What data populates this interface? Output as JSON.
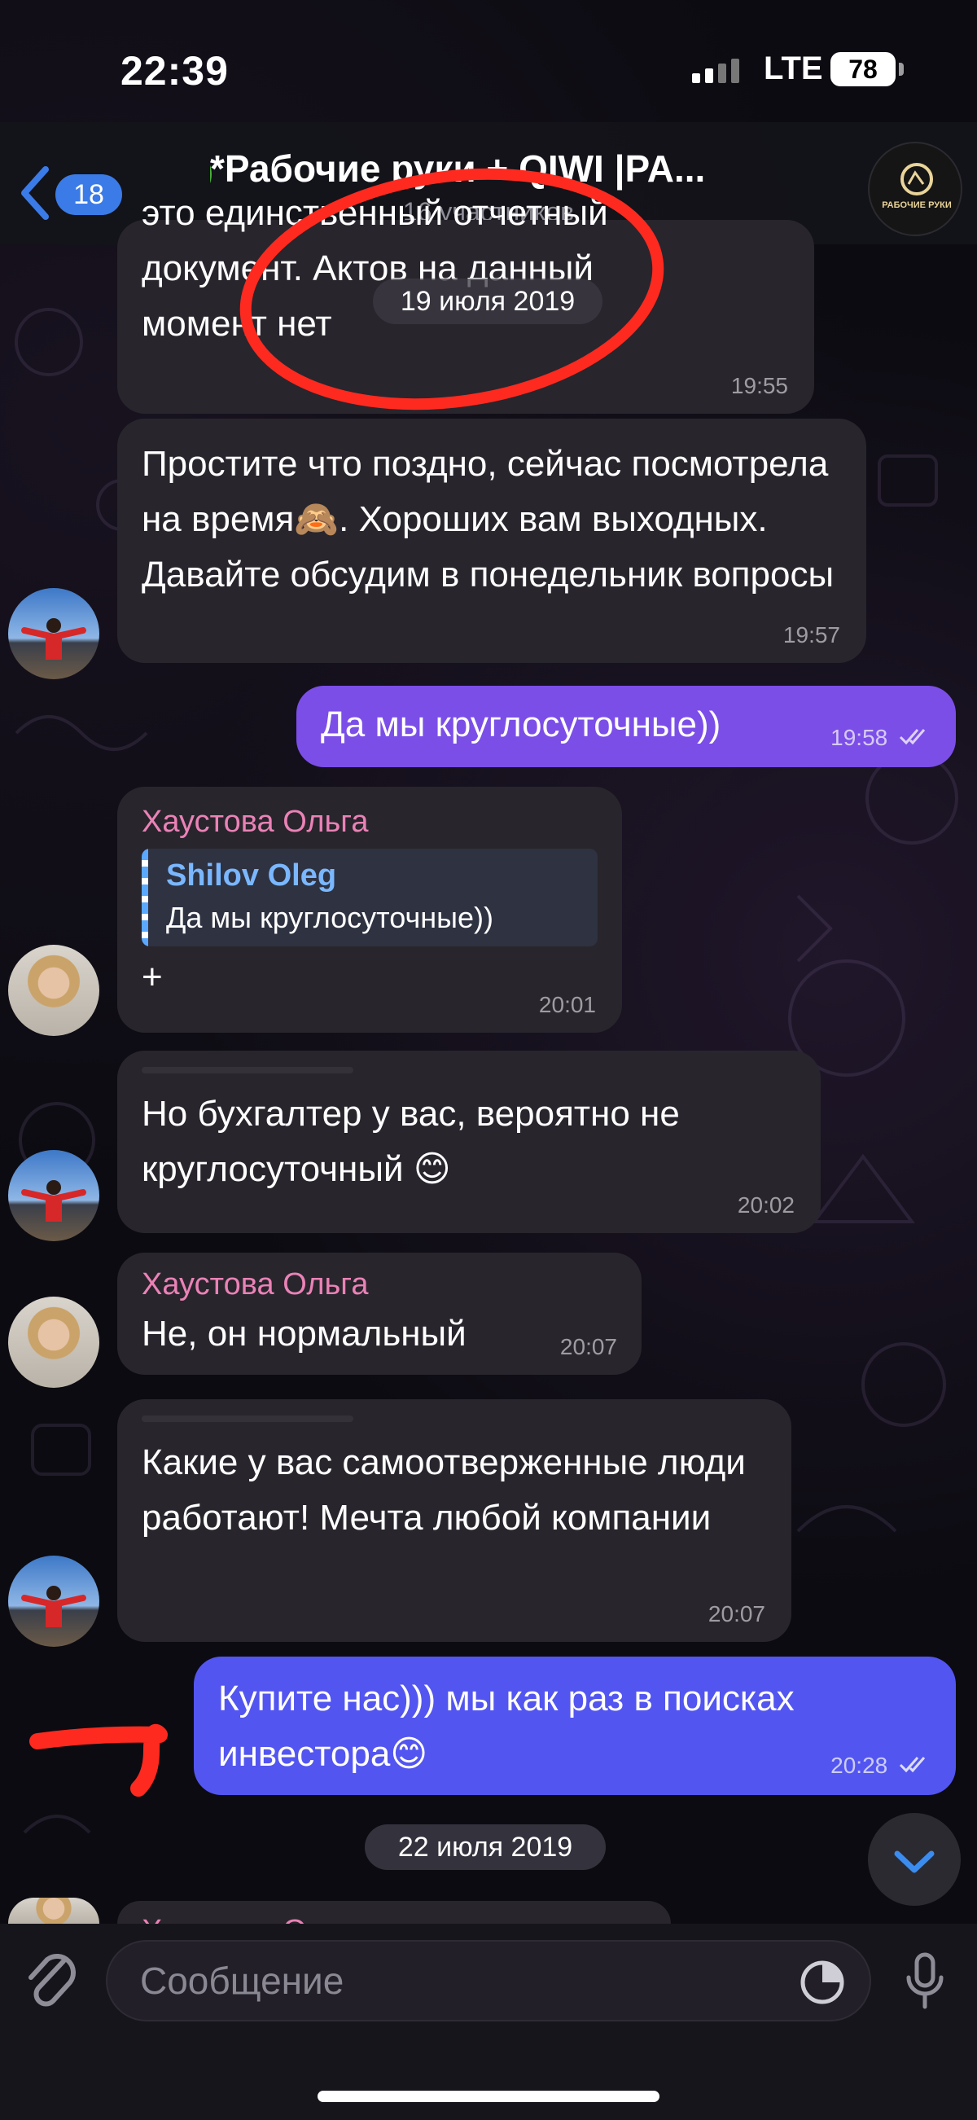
{
  "status_bar": {
    "time": "22:39",
    "network": "LTE",
    "battery": "78"
  },
  "header": {
    "back_count": "18",
    "title": "*Рабочие руки + QIWI |PA...",
    "subtitle": "16 участников",
    "group_avatar_text": "РАБОЧИЕ РУКИ"
  },
  "dates": {
    "first": "19 июля 2019",
    "second": "22 июля 2019"
  },
  "messages": [
    {
      "text": "это единственный отчетный документ. Актов на данный момент нет",
      "time": "19:55"
    },
    {
      "text": "Простите что поздно, сейчас посмотрела на время🙈. Хороших вам выходных. Давайте обсудим в понедельник вопросы",
      "time": "19:57"
    },
    {
      "text": "Да мы круглосуточные))",
      "time": "19:58"
    },
    {
      "sender": "Хаустова Ольга",
      "reply_name": "Shilov Oleg",
      "reply_text": "Да мы круглосуточные))",
      "text": "+",
      "time": "20:01"
    },
    {
      "text": "Но бухгалтер у вас, вероятно не круглосуточный 😊",
      "time": "20:02"
    },
    {
      "sender": "Хаустова Ольга",
      "text": "Не, он нормальный",
      "time": "20:07"
    },
    {
      "text": "Какие у вас самоотверженные люди работают! Мечта любой компании",
      "time": "20:07"
    },
    {
      "text": "Купите нас))) мы как раз в поисках инвестора😊",
      "time": "20:28"
    }
  ],
  "next_sender_preview": "Хаустова О",
  "composer": {
    "placeholder": "Сообщение"
  },
  "colors": {
    "outgoing": "#7b4ee8",
    "outgoing_last": "#5355f0",
    "incoming": "#28252d",
    "sender_name": "#ea82b6",
    "accent": "#3a7be8",
    "annotation": "#ff2a1f"
  },
  "icons": [
    "back-chevron-icon",
    "attach-icon",
    "sticker-icon",
    "microphone-icon",
    "chevron-down-icon",
    "read-checks-icon"
  ]
}
